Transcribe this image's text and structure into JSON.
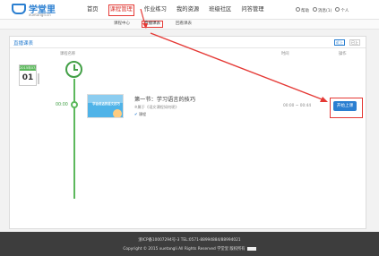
{
  "header": {
    "logo_text": "学堂里",
    "logo_sub": "xuetangli.cn",
    "nav": [
      {
        "label": "首页"
      },
      {
        "label": "课程管理"
      },
      {
        "label": "作业练习"
      },
      {
        "label": "我的资源"
      },
      {
        "label": "班级社区"
      },
      {
        "label": "问答管理"
      }
    ],
    "help": "帮助",
    "messages": "消息(1)",
    "user": "个人"
  },
  "subnav": {
    "items": [
      {
        "label": "课程中心"
      },
      {
        "label": "直播课表"
      },
      {
        "label": "回看课表"
      }
    ]
  },
  "panel": {
    "tab": "直播课表",
    "toggle_on": "近上",
    "toggle_off": "已上",
    "col_name": "课程名称",
    "col_time": "时间",
    "col_action": "操作"
  },
  "timeline": {
    "date_label": "2015年07月",
    "date_day": "01",
    "time": "00:00"
  },
  "lesson": {
    "thumb_text": "学会说话的语文技巧",
    "title": "第一节：学习语言的技巧",
    "subtitle": "※属于《语文课程如何呢》",
    "tag": "课程",
    "duration": "00:00 ~ 00:44",
    "start_label": "开始上课"
  },
  "footer": {
    "line1": "浙ICP备10007294号-3 TEL:0571-88994884/88994021",
    "line2": "Copyright © 2015 xuetangli All Rights Reserved 学堂里 版权所有"
  },
  "colors": {
    "accent": "#2b7fd1",
    "highlight": "#e53935",
    "timeline": "#5cb85c"
  }
}
